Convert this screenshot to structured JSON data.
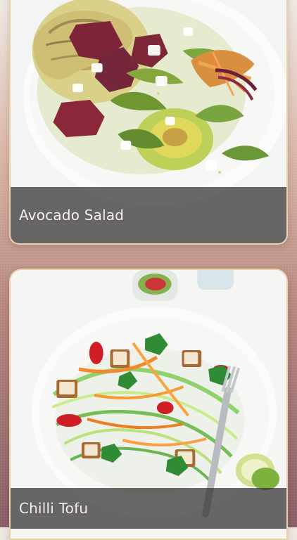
{
  "recipes": [
    {
      "title": "Avocado Salad"
    },
    {
      "title": "Chilli Tofu"
    }
  ],
  "colors": {
    "accent_border": "#e7cfa4",
    "caption_bg": "#312e2e"
  },
  "icons": [
    "salad-photo",
    "tofu-photo"
  ]
}
